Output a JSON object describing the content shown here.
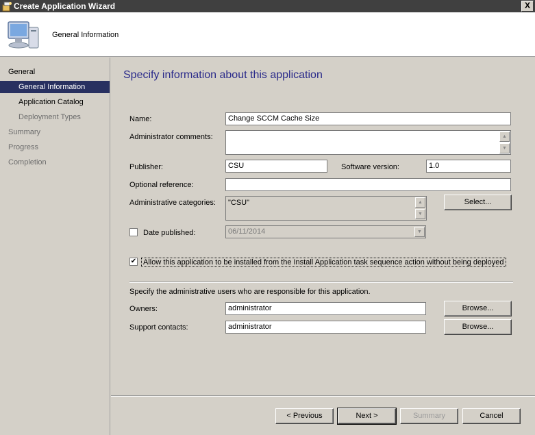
{
  "window": {
    "title": "Create Application Wizard",
    "close_label": "X"
  },
  "header": {
    "title": "General Information"
  },
  "sidebar": {
    "items": [
      {
        "label": "General"
      },
      {
        "label": "General Information"
      },
      {
        "label": "Application Catalog"
      },
      {
        "label": "Deployment Types"
      },
      {
        "label": "Summary"
      },
      {
        "label": "Progress"
      },
      {
        "label": "Completion"
      }
    ]
  },
  "main": {
    "heading": "Specify information about this application",
    "name_label": "Name:",
    "name_value": "Change SCCM Cache Size",
    "admin_comments_label": "Administrator comments:",
    "admin_comments_value": "",
    "publisher_label": "Publisher:",
    "publisher_value": "CSU",
    "software_version_label": "Software version:",
    "software_version_value": "1.0",
    "optional_reference_label": "Optional reference:",
    "optional_reference_value": "",
    "admin_categories_label": "Administrative categories:",
    "admin_categories_value": "\"CSU\"",
    "select_button": "Select...",
    "date_published_label": "Date published:",
    "date_published_value": "06/11/2014",
    "allow_task_sequence_label": "Allow this application to be installed from the Install Application task sequence action without being deployed",
    "owners_intro": "Specify the administrative users who are responsible for this application.",
    "owners_label": "Owners:",
    "owners_value": "administrator",
    "support_contacts_label": "Support contacts:",
    "support_contacts_value": "administrator",
    "browse_button": "Browse..."
  },
  "footer": {
    "previous": "< Previous",
    "next": "Next >",
    "summary": "Summary",
    "cancel": "Cancel"
  },
  "icons": {
    "checkmark": "✔",
    "arrow_up": "▲",
    "arrow_down": "▼"
  }
}
